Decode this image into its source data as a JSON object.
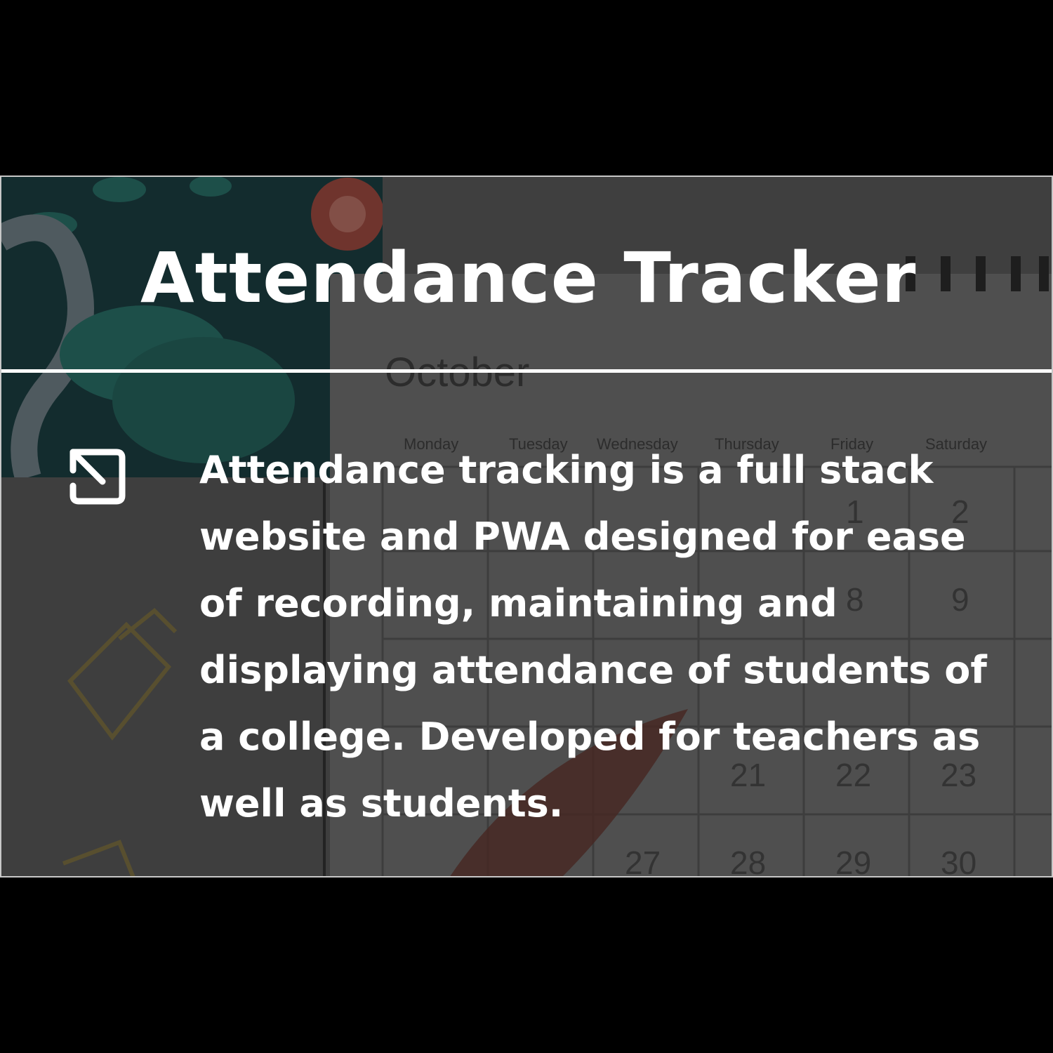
{
  "project": {
    "title": "Attendance Tracker",
    "description": "Attendance tracking is a full stack website and PWA designed for  ease of recording, maintaining and displaying attendance of students of a college.  Developed for teachers as well as students.",
    "open_icon": "open-in-new-icon"
  },
  "background_calendar": {
    "month": "October",
    "weekdays": [
      "Monday",
      "Tuesday",
      "Wednesday",
      "Thursday",
      "Friday",
      "Saturday"
    ],
    "dates_visible": [
      "1",
      "2",
      "8",
      "9",
      "21",
      "22",
      "23",
      "27",
      "28",
      "29",
      "30"
    ]
  },
  "colors": {
    "text": "#ffffff",
    "page_background": "#000000",
    "overlay": "#2f2f2f"
  }
}
